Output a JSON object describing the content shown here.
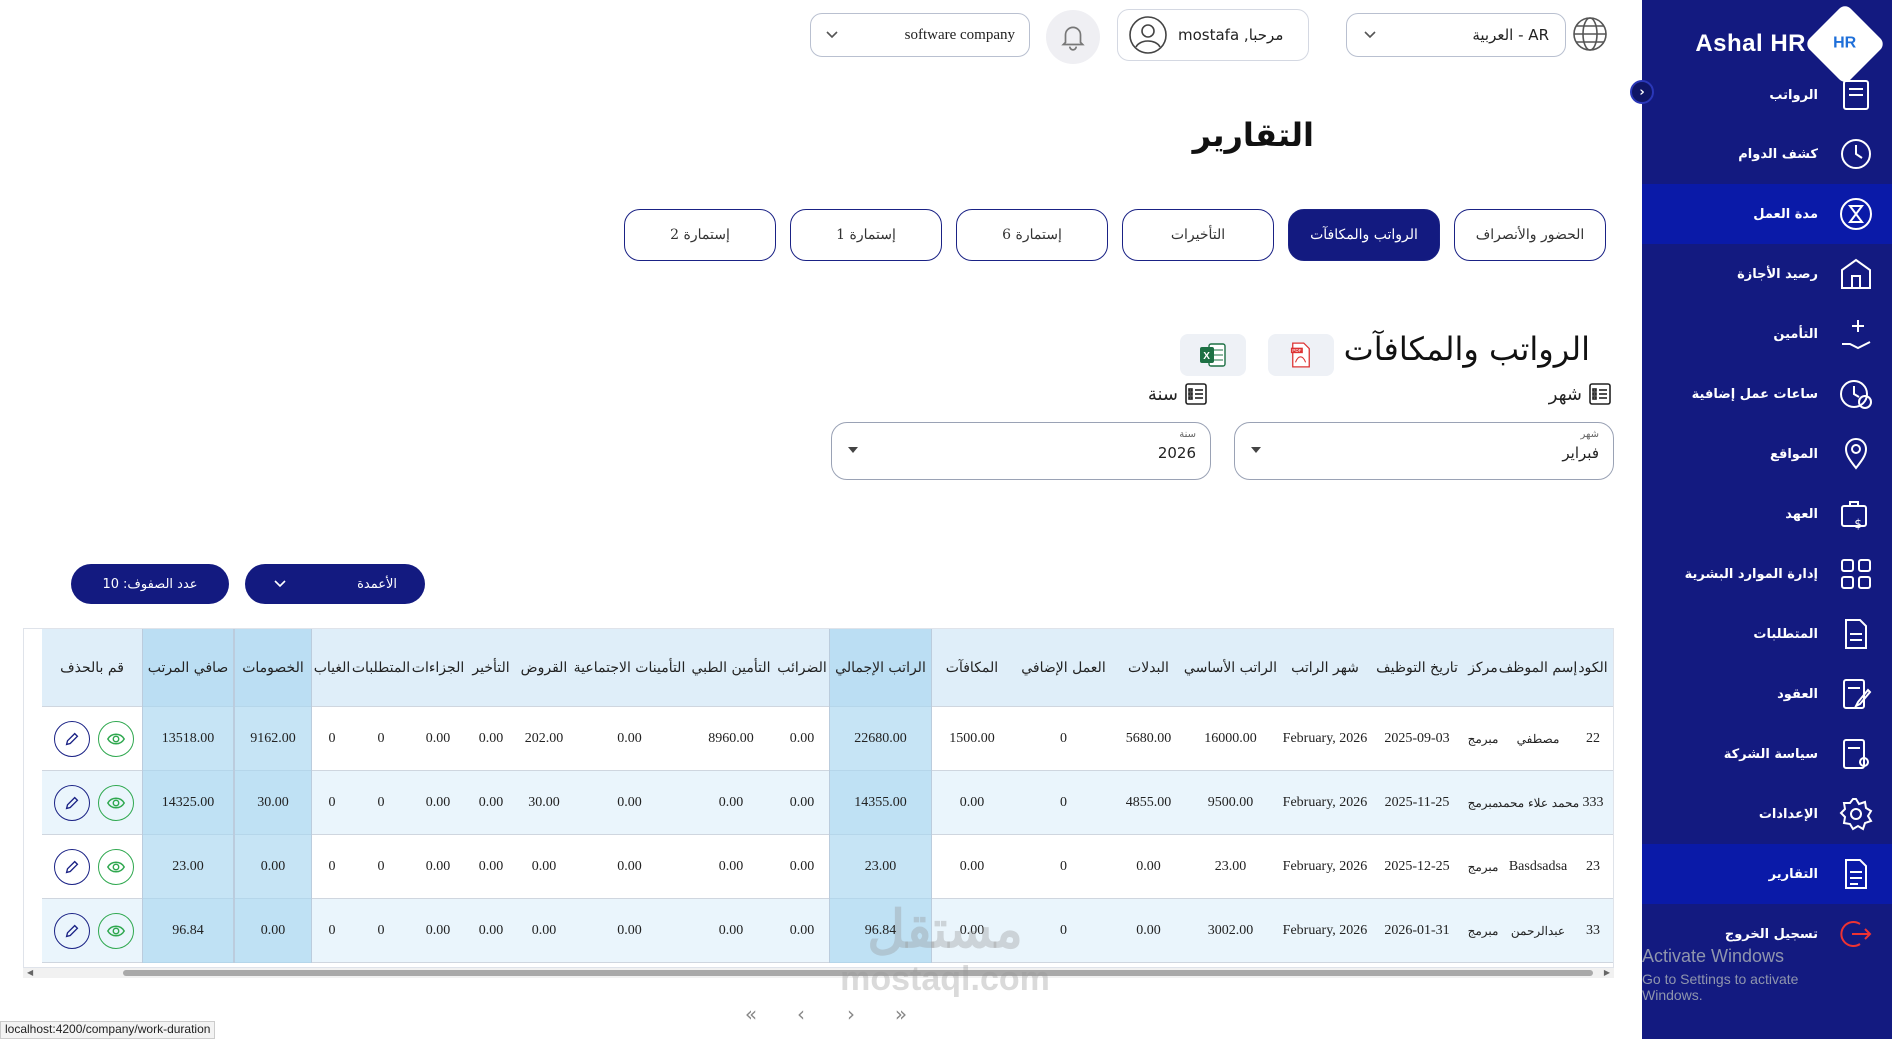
{
  "brand": {
    "name": "Ashal HR",
    "logo_text": "HR"
  },
  "sidebar": {
    "items": [
      {
        "label": "الرواتب",
        "icon": "payroll-icon"
      },
      {
        "label": "كشف الدوام",
        "icon": "clock-icon"
      },
      {
        "label": "مدة العمل",
        "icon": "hourglass-icon",
        "active": true
      },
      {
        "label": "رصيد الأجازة",
        "icon": "house-icon"
      },
      {
        "label": "التأمين",
        "icon": "insurance-hand-icon"
      },
      {
        "label": "ساعات عمل إضافية",
        "icon": "overtime-clock-icon"
      },
      {
        "label": "المواقع",
        "icon": "location-pin-icon"
      },
      {
        "label": "العهد",
        "icon": "briefcase-dollar-icon"
      },
      {
        "label": "إدارة الموارد البشرية",
        "icon": "grid-icon"
      },
      {
        "label": "المتطلبات",
        "icon": "document-list-icon"
      },
      {
        "label": "العقود",
        "icon": "contract-pen-icon"
      },
      {
        "label": "سياسة الشركة",
        "icon": "policy-document-icon"
      },
      {
        "label": "الإعدادات",
        "icon": "gear-icon"
      },
      {
        "label": "التقارير",
        "icon": "report-document-icon",
        "active": true
      },
      {
        "label": "تسجيل الخروج",
        "icon": "logout-icon"
      }
    ]
  },
  "topbar": {
    "language": "العربية - AR",
    "greeting": "مرحبا, mostafa",
    "company": "software company"
  },
  "page_title": "التقارير",
  "tabs": [
    "الحضور والأنصراف",
    "الرواتب والمكافآت",
    "التأخيرات",
    "إستمارة 6",
    "إستمارة 1",
    "إستمارة 2"
  ],
  "active_tab": "الرواتب والمكافآت",
  "section": {
    "title": "الرواتب والمكافآت",
    "month_label": "شهر",
    "year_label": "سنة",
    "month_field": {
      "label": "شهر",
      "value": "فبراير"
    },
    "year_field": {
      "label": "سنة",
      "value": "2026"
    }
  },
  "controls": {
    "columns_label": "الأعمدة",
    "rows_label": "عدد الصفوف:",
    "rows_value": "10"
  },
  "table": {
    "headers": [
      "الكود",
      "إسم الموظف",
      "مركز",
      "تاريخ التوظيف",
      "شهر الراتب",
      "الراتب الأساسي",
      "البدلات",
      "العمل الإضافي",
      "المكافآت",
      "الراتب الإجمالي",
      "الضرائب",
      "التأمين الطبي",
      "التأمينات الاجتماعية",
      "القروض",
      "التأخير",
      "الجزاءات",
      "المتطلبات",
      "الغياب",
      "الخصومات",
      "صافي المرتب",
      "قم بالحذف"
    ],
    "rows": [
      [
        "22",
        "مصطفي",
        "مبرمج",
        "2025-09-03",
        "February, 2026",
        "16000.00",
        "5680.00",
        "0",
        "1500.00",
        "22680.00",
        "0.00",
        "8960.00",
        "0.00",
        "202.00",
        "0.00",
        "0.00",
        "0",
        "0",
        "9162.00",
        "13518.00"
      ],
      [
        "333",
        "محمد علاء محمد",
        "مبرمج",
        "2025-11-25",
        "February, 2026",
        "9500.00",
        "4855.00",
        "0",
        "0.00",
        "14355.00",
        "0.00",
        "0.00",
        "0.00",
        "30.00",
        "0.00",
        "0.00",
        "0",
        "0",
        "30.00",
        "14325.00"
      ],
      [
        "23",
        "Basdsadsa",
        "مبرمج",
        "2025-12-25",
        "February, 2026",
        "23.00",
        "0.00",
        "0",
        "0.00",
        "23.00",
        "0.00",
        "0.00",
        "0.00",
        "0.00",
        "0.00",
        "0.00",
        "0",
        "0",
        "0.00",
        "23.00"
      ],
      [
        "33",
        "عبدالرحمن",
        "مبرمج",
        "2026-01-31",
        "February, 2026",
        "3002.00",
        "0.00",
        "0",
        "0.00",
        "96.84",
        "0.00",
        "0.00",
        "0.00",
        "0.00",
        "0.00",
        "0.00",
        "0",
        "0",
        "0.00",
        "96.84"
      ]
    ]
  },
  "status_url": "localhost:4200/company/work-duration",
  "activate_windows": {
    "line1": "Activate Windows",
    "line2": "Go to Settings to activate Windows."
  },
  "watermark": {
    "line1": "مستقل",
    "line2": "mostaql.com"
  },
  "colors": {
    "primary": "#131a80",
    "highlight_col": "#c9e6f6",
    "row_alt": "#eaf5fc",
    "eye_green": "#2fa84f"
  }
}
